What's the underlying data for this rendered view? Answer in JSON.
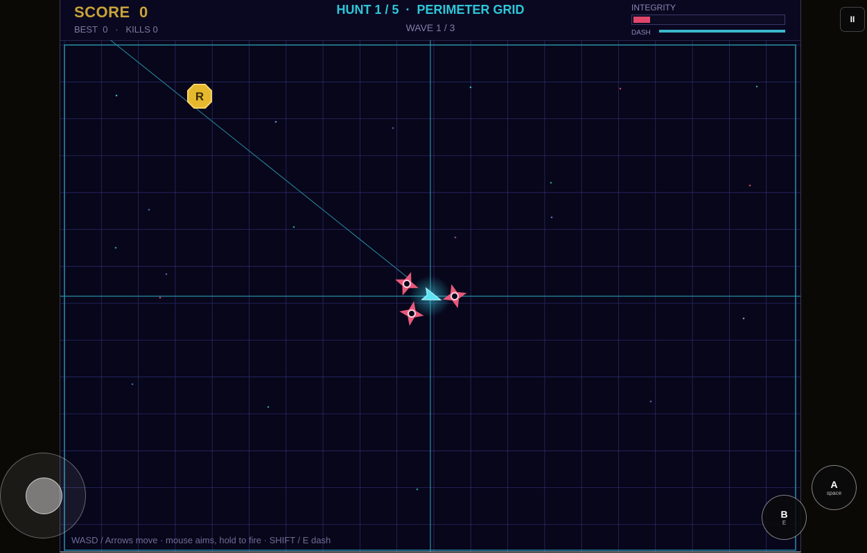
{
  "hud": {
    "score_label": "SCORE",
    "score_value": "0",
    "best_label": "BEST",
    "best_value": "0",
    "kills_label": "KILLS",
    "kills_value": "0",
    "stats_separator": "·",
    "hunt_text": "HUNT 1 / 5",
    "title_separator": "·",
    "level_name": "PERIMETER GRID",
    "wave_text": "WAVE 1 / 3",
    "integrity_label": "INTEGRITY",
    "integrity_fraction": 0.11,
    "dash_label": "DASH",
    "dash_fraction": 1.0
  },
  "arena": {
    "pickup_letter": "R",
    "help_text": "WASD / Arrows move  ·  mouse aims, hold to fire  ·  SHIFT / E dash"
  },
  "controls": {
    "pause_symbol": "II",
    "a_label": "A",
    "a_sub": "space",
    "b_label": "B",
    "b_sub": "E"
  },
  "colors": {
    "score": "#c9a23a",
    "title": "#2ec7d8",
    "enemy": "#e8587a",
    "player": "#3ad6ea",
    "grid": "#2a2a6a",
    "pickup": "#e6b82e"
  }
}
